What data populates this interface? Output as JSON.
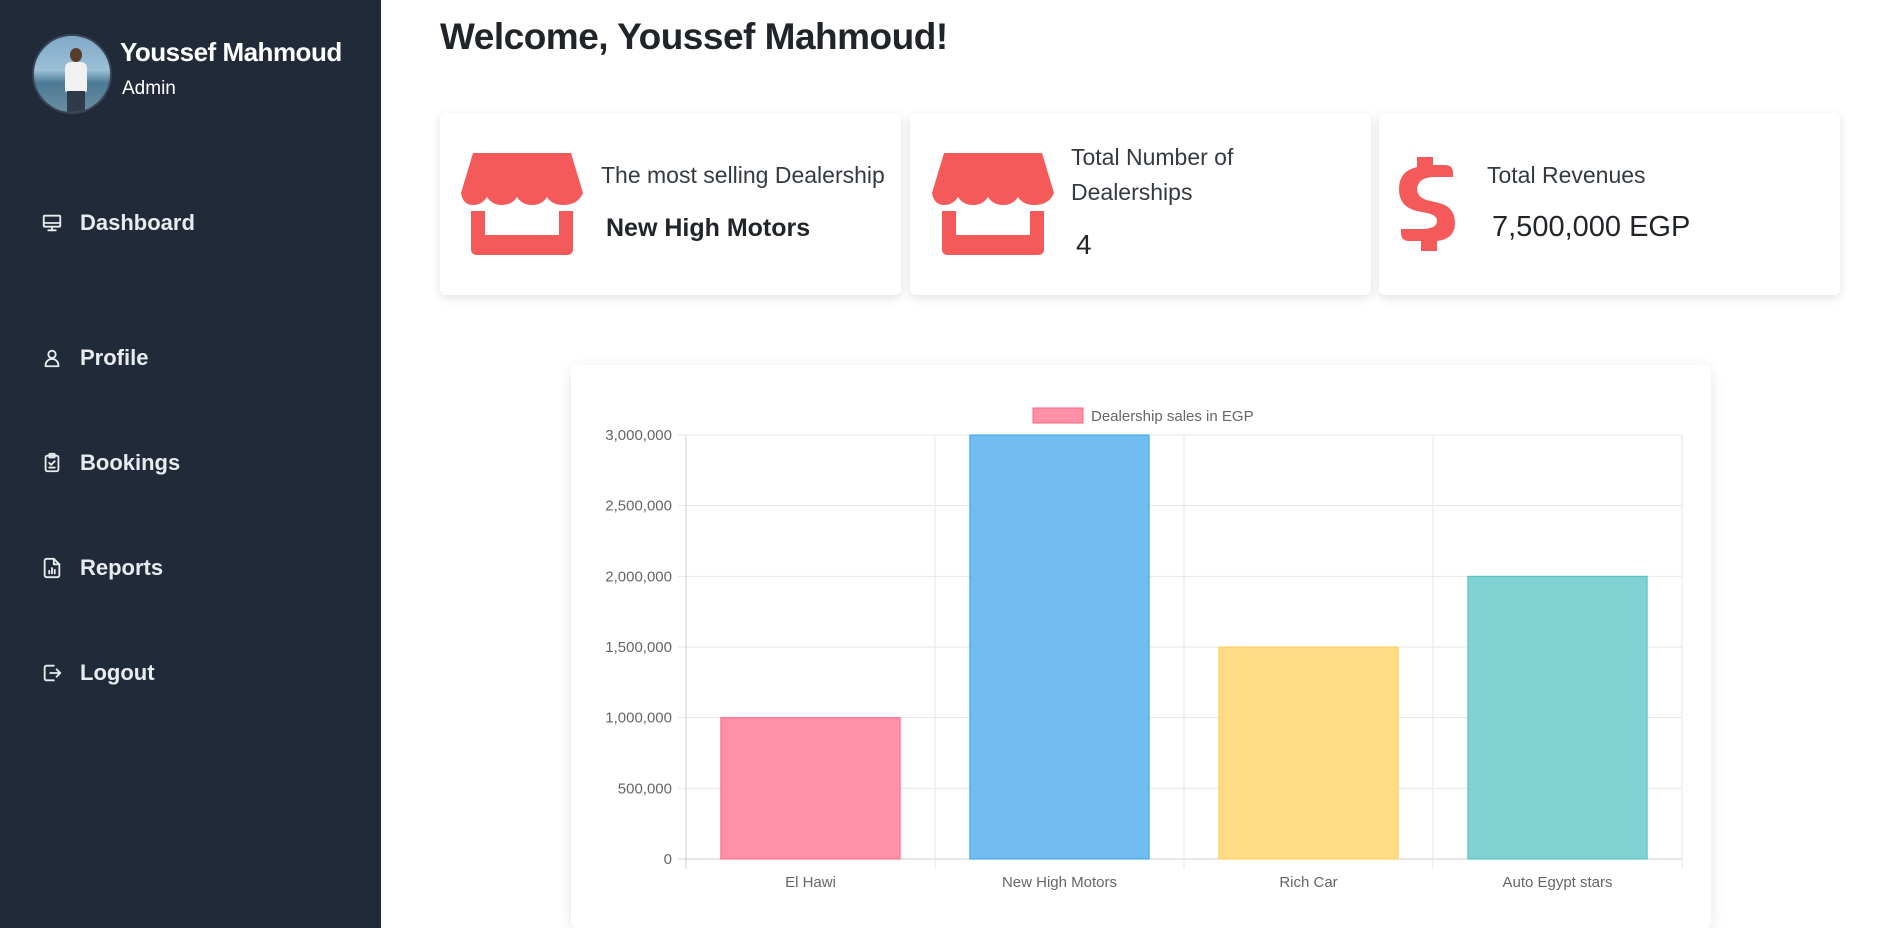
{
  "user": {
    "name": "Youssef Mahmoud",
    "role": "Admin"
  },
  "sidebar": {
    "items": [
      {
        "label": "Dashboard",
        "icon": "monitor-icon"
      },
      {
        "label": "Profile",
        "icon": "user-icon"
      },
      {
        "label": "Bookings",
        "icon": "clipboard-icon"
      },
      {
        "label": "Reports",
        "icon": "report-icon"
      },
      {
        "label": "Logout",
        "icon": "logout-icon"
      }
    ]
  },
  "main": {
    "welcome": "Welcome, Youssef Mahmoud!",
    "cards": [
      {
        "title": "The most selling Dealership",
        "value": "New High Motors",
        "icon": "store-icon"
      },
      {
        "title": "Total Number of Dealerships",
        "value": "4",
        "icon": "store-icon"
      },
      {
        "title": "Total Revenues",
        "value": "7,500,000 EGP",
        "icon": "dollar-icon"
      }
    ]
  },
  "colors": {
    "sidebar_bg": "#212a39",
    "accent": "#f55a5a"
  },
  "chart_data": {
    "type": "bar",
    "categories": [
      "El Hawi",
      "New High Motors",
      "Rich Car",
      "Auto Egypt stars"
    ],
    "series": [
      {
        "name": "Dealership sales in EGP",
        "values": [
          1000000,
          3000000,
          1500000,
          2000000
        ]
      }
    ],
    "ylim": [
      0,
      3000000
    ],
    "yticks": [
      "0",
      "500,000",
      "1,000,000",
      "1,500,000",
      "2,000,000",
      "2,500,000",
      "3,000,000"
    ],
    "bar_colors": [
      "#ff90a8",
      "#71bcf0",
      "#ffdb86",
      "#80d3d2"
    ],
    "bar_borders": [
      "#ff6384",
      "#36a2eb",
      "#ffce56",
      "#4bc0c0"
    ],
    "grid": true,
    "legend": "top-center"
  }
}
